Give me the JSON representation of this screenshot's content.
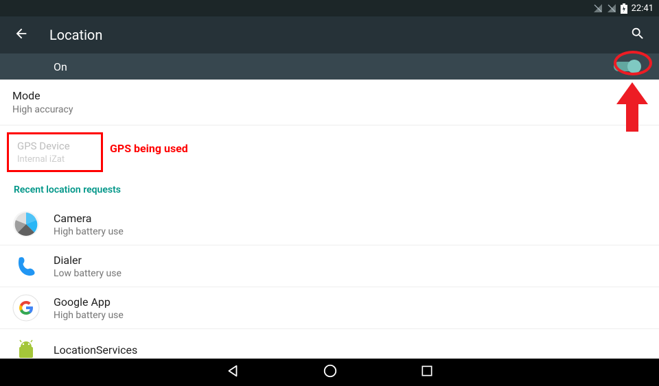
{
  "status": {
    "time": "22:41"
  },
  "appbar": {
    "title": "Location"
  },
  "toggle": {
    "label": "On"
  },
  "mode": {
    "title": "Mode",
    "subtitle": "High accuracy"
  },
  "gps": {
    "title": "GPS Device",
    "subtitle": "Internal iZat"
  },
  "annotation": {
    "gps": "GPS being used"
  },
  "section": {
    "recent": "Recent location requests"
  },
  "apps": [
    {
      "name": "Camera",
      "usage": "High battery use"
    },
    {
      "name": "Dialer",
      "usage": "Low battery use"
    },
    {
      "name": "Google App",
      "usage": "High battery use"
    },
    {
      "name": "LocationServices",
      "usage": ""
    }
  ]
}
